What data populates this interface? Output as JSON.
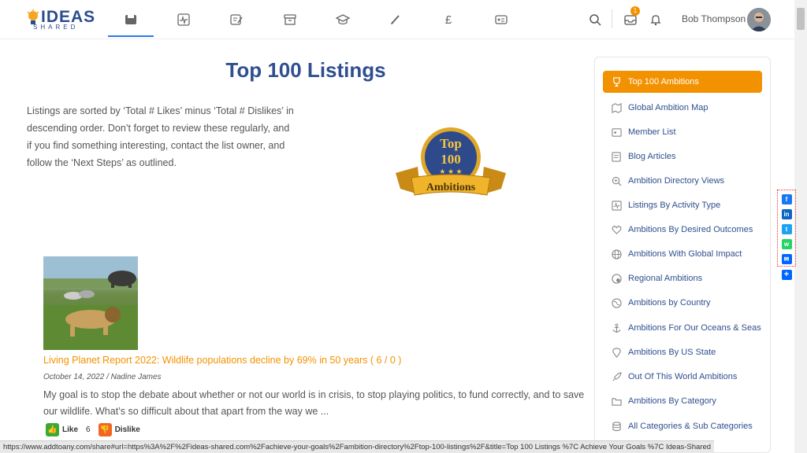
{
  "header": {
    "logo_main": "IDEAS",
    "logo_sub": "SHARED",
    "notification_count": "1",
    "username": "Bob Thompson"
  },
  "page": {
    "title": "Top 100 Listings",
    "intro": "Listings are sorted by ‘Total # Likes’ minus ‘Total # Dislikes’ in descending order. Don’t forget to review these regularly, and if you find something interesting, contact the list owner, and follow the ‘Next Steps’ as outlined.",
    "badge_line1": "Top",
    "badge_line2": "100",
    "badge_ribbon": "Ambitions"
  },
  "listing": {
    "title": "Living Planet Report 2022: Wildlife populations decline by 69% in 50 years ( 6 / 0 )",
    "date": "October 14, 2022",
    "author": "Nadine James",
    "separator": "/",
    "body": "My goal is to stop the debate about whether or not our world is in crisis, to stop playing politics, to fund correctly, and to save our wildlife. What’s so difficult about that apart from the way we ...",
    "like_label": "Like",
    "like_count": "6",
    "dislike_label": "Dislike"
  },
  "sidebar": {
    "items": [
      {
        "label": "Top 100 Ambitions",
        "icon": "trophy-icon"
      },
      {
        "label": "Global Ambition Map",
        "icon": "map-icon"
      },
      {
        "label": "Member List",
        "icon": "id-card-icon"
      },
      {
        "label": "Blog Articles",
        "icon": "article-icon"
      },
      {
        "label": "Ambition Directory Views",
        "icon": "search-plus-icon"
      },
      {
        "label": "Listings By Activity Type",
        "icon": "activity-icon"
      },
      {
        "label": "Ambitions By Desired Outcomes",
        "icon": "heart-icon"
      },
      {
        "label": "Ambitions With Global Impact",
        "icon": "globe-icon"
      },
      {
        "label": "Regional Ambitions",
        "icon": "region-icon"
      },
      {
        "label": "Ambitions by Country",
        "icon": "country-icon"
      },
      {
        "label": "Ambitions For Our Oceans & Seas",
        "icon": "anchor-icon"
      },
      {
        "label": "Ambitions By US State",
        "icon": "map-pin-icon"
      },
      {
        "label": "Out Of This World Ambitions",
        "icon": "rocket-icon"
      },
      {
        "label": "Ambitions By Category",
        "icon": "folder-icon"
      },
      {
        "label": "All Categories & Sub Categories",
        "icon": "database-icon"
      }
    ]
  },
  "status_url": "https://www.addtoany.com/share#url=https%3A%2F%2Fideas-shared.com%2Fachieve-your-goals%2Fambition-directory%2Ftop-100-listings%2F&title=Top 100 Listings %7C Achieve Your Goals %7C Ideas-Shared",
  "colors": {
    "accent": "#f39200",
    "brand": "#2f4f8f"
  }
}
